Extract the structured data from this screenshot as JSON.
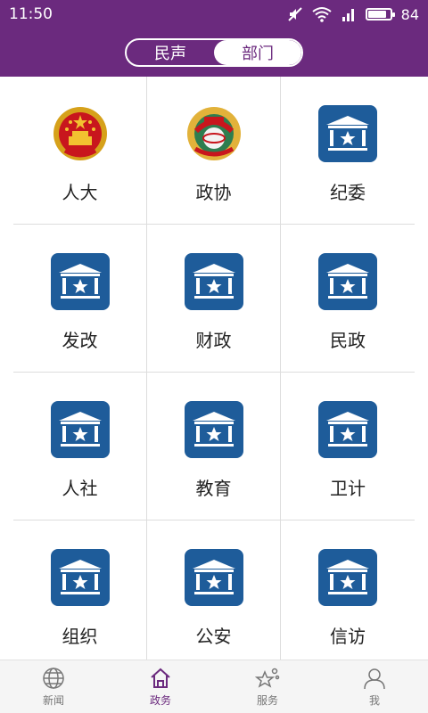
{
  "status_bar": {
    "time": "11:50",
    "battery": "84",
    "battery_level": 0.84
  },
  "header": {
    "segments": [
      {
        "label": "民声",
        "active": false
      },
      {
        "label": "部门",
        "active": true
      }
    ]
  },
  "grid": {
    "items": [
      {
        "label": "人大",
        "icon": "national-emblem-icon"
      },
      {
        "label": "政协",
        "icon": "cppcc-emblem-icon"
      },
      {
        "label": "纪委",
        "icon": "government-building-icon"
      },
      {
        "label": "发改",
        "icon": "government-building-icon"
      },
      {
        "label": "财政",
        "icon": "government-building-icon"
      },
      {
        "label": "民政",
        "icon": "government-building-icon"
      },
      {
        "label": "人社",
        "icon": "government-building-icon"
      },
      {
        "label": "教育",
        "icon": "government-building-icon"
      },
      {
        "label": "卫计",
        "icon": "government-building-icon"
      },
      {
        "label": "组织",
        "icon": "government-building-icon"
      },
      {
        "label": "公安",
        "icon": "government-building-icon"
      },
      {
        "label": "信访",
        "icon": "government-building-icon"
      }
    ]
  },
  "tabbar": {
    "tabs": [
      {
        "label": "新闻",
        "icon": "globe-icon",
        "active": false
      },
      {
        "label": "政务",
        "icon": "home-icon",
        "active": true
      },
      {
        "label": "服务",
        "icon": "stars-icon",
        "active": false
      },
      {
        "label": "我",
        "icon": "user-icon",
        "active": false
      }
    ]
  },
  "colors": {
    "brand": "#6b2a7e",
    "icon_blue": "#1e5c9a"
  }
}
